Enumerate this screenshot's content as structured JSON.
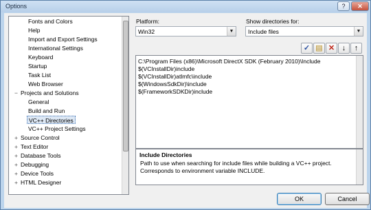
{
  "window": {
    "title": "Options",
    "help_label": "?",
    "close_label": "✕"
  },
  "tree": {
    "items": [
      "Fonts and Colors",
      "Help",
      "Import and Export Settings",
      "International Settings",
      "Keyboard",
      "Startup",
      "Task List",
      "Web Browser",
      "Projects and Solutions",
      "General",
      "Build and Run",
      "VC++ Directories",
      "VC++ Project Settings",
      "Source Control",
      "Text Editor",
      "Database Tools",
      "Debugging",
      "Device Tools",
      "HTML Designer"
    ],
    "expander_collapsed": "+",
    "expander_expanded": "−"
  },
  "platform": {
    "label": "Platform:",
    "value": "Win32"
  },
  "show_dirs": {
    "label": "Show directories for:",
    "value": "Include files"
  },
  "toolbar": {
    "check_glyph": "✓",
    "new_folder_glyph": "▤",
    "delete_glyph": "✕",
    "down_glyph": "↓",
    "up_glyph": "↑"
  },
  "directories": [
    "C:\\Program Files (x86)\\Microsoft DirectX SDK (February 2010)\\Include",
    "$(VCInstallDir)include",
    "$(VCInstallDir)atlmfc\\include",
    "$(WindowsSdkDir)\\include",
    "$(FrameworkSDKDir)include"
  ],
  "description": {
    "title": "Include Directories",
    "text": "Path to use when searching for include files while building a VC++ project. Corresponds to environment variable INCLUDE."
  },
  "buttons": {
    "ok": "OK",
    "cancel": "Cancel"
  },
  "colors": {
    "title_bar": "#bcd4ec",
    "selection": "#dde8f5",
    "dialog_bg": "#f0f0f0"
  },
  "icons": {
    "check": "checkmark-icon",
    "new_line": "new-folder-icon",
    "delete": "delete-icon",
    "move_down": "arrow-down-icon",
    "move_up": "arrow-up-icon"
  }
}
